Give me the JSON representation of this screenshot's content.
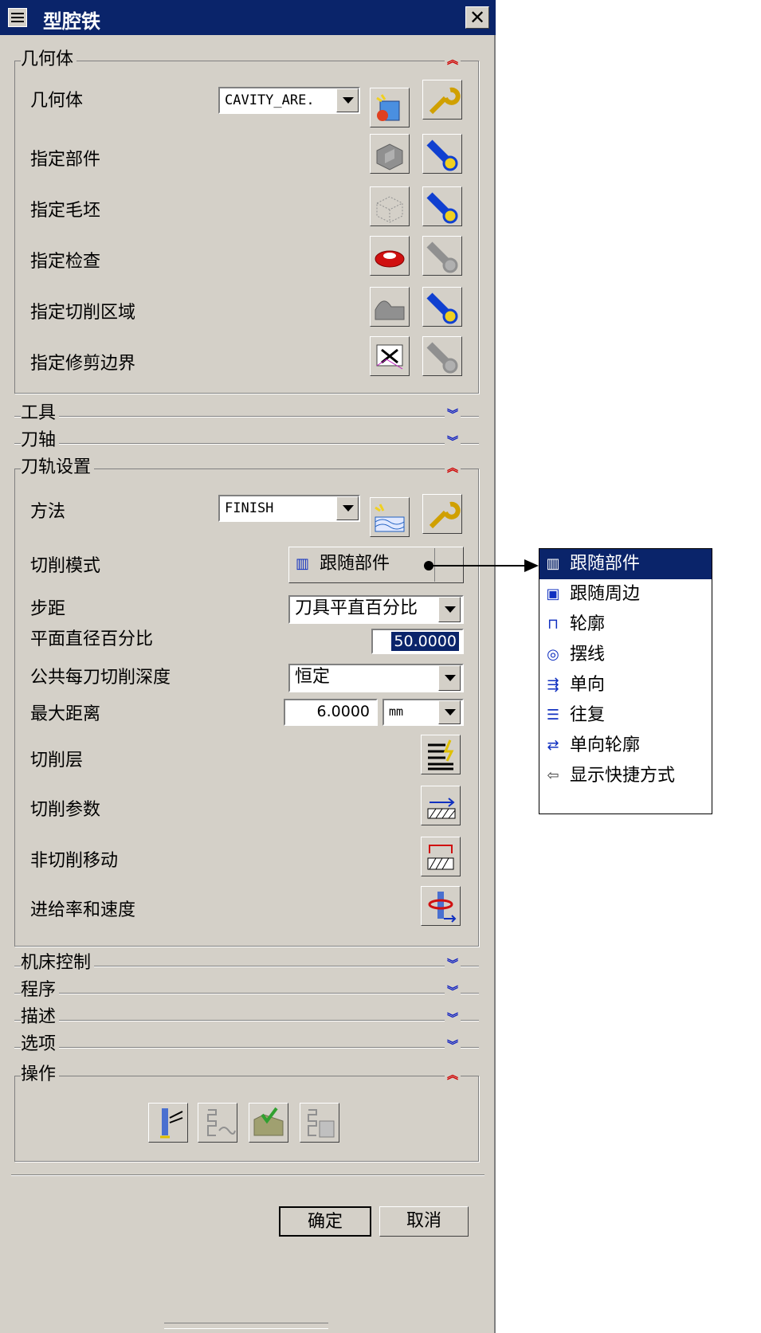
{
  "dialog": {
    "title": "型腔铁",
    "close_glyph": "✕"
  },
  "sections": {
    "geometry": {
      "label": "几何体",
      "rows": {
        "geometry": "几何体",
        "part": "指定部件",
        "blank": "指定毛坯",
        "check": "指定检查",
        "cut_area": "指定切削区域",
        "trim": "指定修剪边界"
      },
      "geometry_select": "CAVITY_ARE."
    },
    "tool": {
      "label": "工具"
    },
    "axis": {
      "label": "刀轴"
    },
    "path": {
      "label": "刀轨设置",
      "method_label": "方法",
      "method_value": "FINISH",
      "cut_pattern_label": "切削模式",
      "cut_pattern_value": "跟随部件",
      "stepover_label": "步距",
      "stepover_value": "刀具平直百分比",
      "percent_label": "平面直径百分比",
      "percent_value": "50.0000",
      "depth_label": "公共每刀切削深度",
      "depth_value": "恒定",
      "max_dist_label": "最大距离",
      "max_dist_value": "6.0000",
      "max_dist_unit": "mm",
      "cut_levels_label": "切削层",
      "cut_params_label": "切削参数",
      "non_cut_label": "非切削移动",
      "feeds_label": "进给率和速度"
    },
    "machine": {
      "label": "机床控制"
    },
    "program": {
      "label": "程序"
    },
    "desc": {
      "label": "描述"
    },
    "options": {
      "label": "选项"
    },
    "actions": {
      "label": "操作"
    }
  },
  "chevrons": {
    "up": "≈",
    "down": "≈"
  },
  "footer": {
    "ok": "确定",
    "cancel": "取消"
  },
  "popup_menu": {
    "items": [
      {
        "label": "跟随部件",
        "icon": "follow-part-icon",
        "selected": true
      },
      {
        "label": "跟随周边",
        "icon": "follow-periphery-icon"
      },
      {
        "label": "轮廓",
        "icon": "profile-icon"
      },
      {
        "label": "摆线",
        "icon": "trochoidal-icon"
      },
      {
        "label": "单向",
        "icon": "zig-icon"
      },
      {
        "label": "往复",
        "icon": "zig-zag-icon"
      },
      {
        "label": "单向轮廓",
        "icon": "zig-with-contour-icon"
      },
      {
        "label": "显示快捷方式",
        "icon": "show-shortcuts-icon"
      }
    ]
  },
  "colors": {
    "title_bar": "#0a246a",
    "dialog_bg": "#d4d0c8",
    "menu_selected": "#0a246a",
    "field_selected": "#0a246a"
  }
}
